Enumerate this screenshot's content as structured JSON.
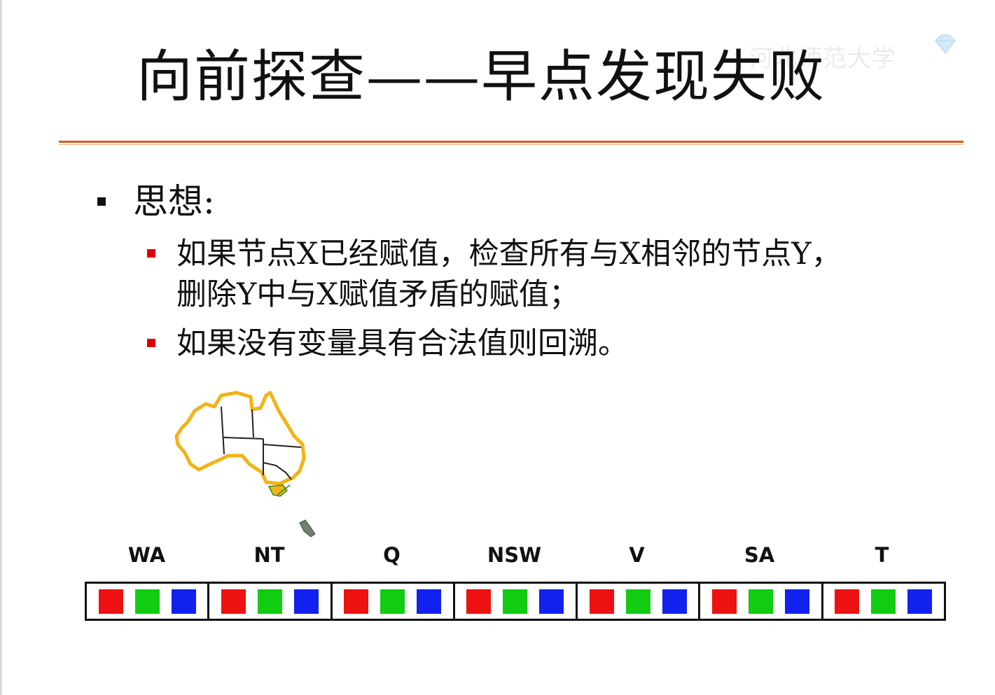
{
  "slide": {
    "title": "向前探查——早点发现失败",
    "idea_label": "思想:",
    "points": [
      "如果节点X已经赋值，检查所有与X相邻的节点Y，",
      "删除Y中与X赋值矛盾的赋值；",
      "如果没有变量具有合法值则回溯。"
    ]
  },
  "watermark": {
    "text": "河北师范大学",
    "logo": "diamond-logo-icon"
  },
  "variables": [
    "WA",
    "NT",
    "Q",
    "NSW",
    "V",
    "SA",
    "T"
  ],
  "domain_colors": [
    "#ee1111",
    "#11cc11",
    "#1122ee"
  ],
  "colors": {
    "accent_rule": "#e2561e",
    "bullet_red": "#e10000",
    "map_outline": "#f2b316"
  }
}
